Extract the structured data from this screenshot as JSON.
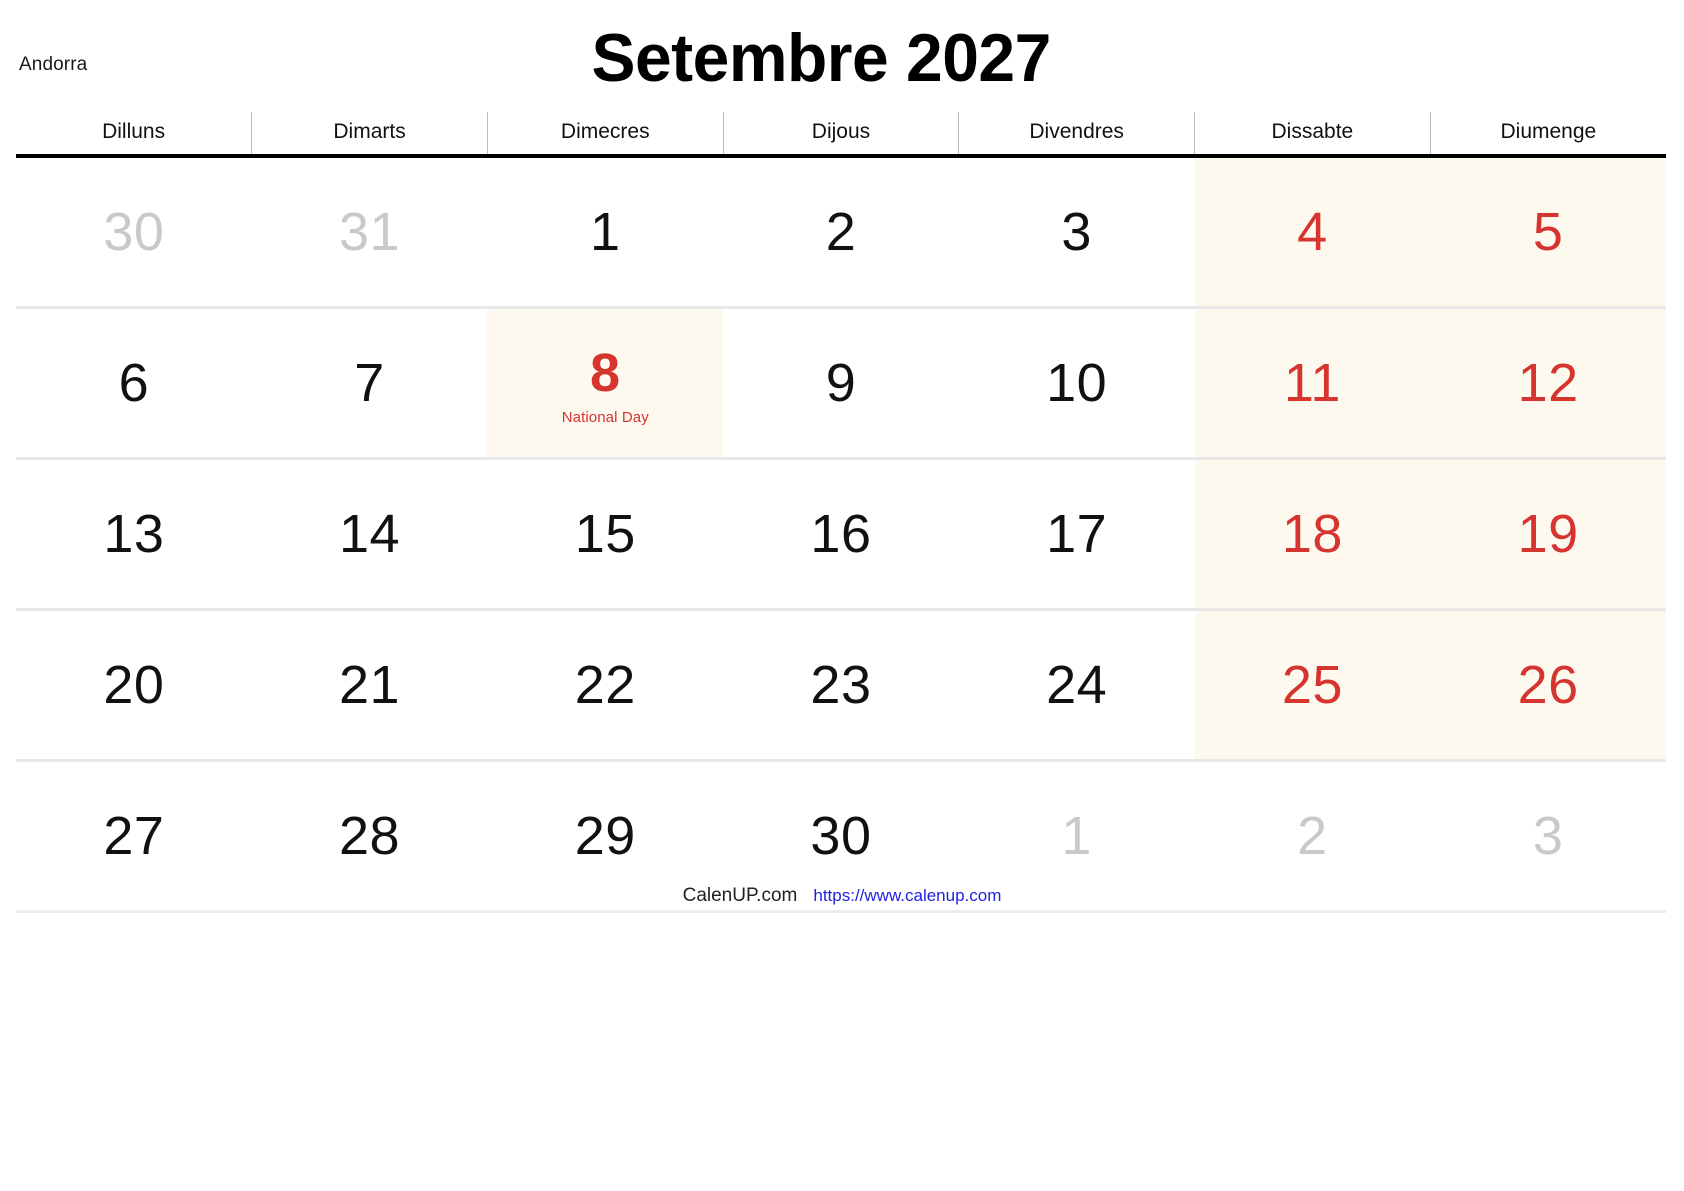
{
  "header": {
    "country": "Andorra",
    "title": "Setembre 2027"
  },
  "weekdays": [
    "Dilluns",
    "Dimarts",
    "Dimecres",
    "Dijous",
    "Divendres",
    "Dissabte",
    "Diumenge"
  ],
  "colors": {
    "holiday_red": "#d5342f",
    "weekend_shade": "#fdf9ef",
    "muted_gray": "#c9c9c9",
    "link_blue": "#2222dd",
    "header_rule": "#000000"
  },
  "weeks": [
    [
      {
        "num": "30",
        "muted": true,
        "shade": false,
        "event": ""
      },
      {
        "num": "31",
        "muted": true,
        "shade": false,
        "event": ""
      },
      {
        "num": "1",
        "muted": false,
        "shade": false,
        "event": ""
      },
      {
        "num": "2",
        "muted": false,
        "shade": false,
        "event": ""
      },
      {
        "num": "3",
        "muted": false,
        "shade": false,
        "event": ""
      },
      {
        "num": "4",
        "muted": false,
        "shade": true,
        "weekend": true,
        "event": ""
      },
      {
        "num": "5",
        "muted": false,
        "shade": true,
        "weekend": true,
        "event": ""
      }
    ],
    [
      {
        "num": "6",
        "muted": false,
        "shade": false,
        "event": ""
      },
      {
        "num": "7",
        "muted": false,
        "shade": false,
        "event": ""
      },
      {
        "num": "8",
        "muted": false,
        "shade": true,
        "holiday": true,
        "event": "National Day"
      },
      {
        "num": "9",
        "muted": false,
        "shade": false,
        "event": ""
      },
      {
        "num": "10",
        "muted": false,
        "shade": false,
        "event": ""
      },
      {
        "num": "11",
        "muted": false,
        "shade": true,
        "weekend": true,
        "event": ""
      },
      {
        "num": "12",
        "muted": false,
        "shade": true,
        "weekend": true,
        "event": ""
      }
    ],
    [
      {
        "num": "13",
        "muted": false,
        "shade": false,
        "event": ""
      },
      {
        "num": "14",
        "muted": false,
        "shade": false,
        "event": ""
      },
      {
        "num": "15",
        "muted": false,
        "shade": false,
        "event": ""
      },
      {
        "num": "16",
        "muted": false,
        "shade": false,
        "event": ""
      },
      {
        "num": "17",
        "muted": false,
        "shade": false,
        "event": ""
      },
      {
        "num": "18",
        "muted": false,
        "shade": true,
        "weekend": true,
        "event": ""
      },
      {
        "num": "19",
        "muted": false,
        "shade": true,
        "weekend": true,
        "event": ""
      }
    ],
    [
      {
        "num": "20",
        "muted": false,
        "shade": false,
        "event": ""
      },
      {
        "num": "21",
        "muted": false,
        "shade": false,
        "event": ""
      },
      {
        "num": "22",
        "muted": false,
        "shade": false,
        "event": ""
      },
      {
        "num": "23",
        "muted": false,
        "shade": false,
        "event": ""
      },
      {
        "num": "24",
        "muted": false,
        "shade": false,
        "event": ""
      },
      {
        "num": "25",
        "muted": false,
        "shade": true,
        "weekend": true,
        "event": ""
      },
      {
        "num": "26",
        "muted": false,
        "shade": true,
        "weekend": true,
        "event": ""
      }
    ],
    [
      {
        "num": "27",
        "muted": false,
        "shade": false,
        "event": ""
      },
      {
        "num": "28",
        "muted": false,
        "shade": false,
        "event": ""
      },
      {
        "num": "29",
        "muted": false,
        "shade": false,
        "event": ""
      },
      {
        "num": "30",
        "muted": false,
        "shade": false,
        "event": ""
      },
      {
        "num": "1",
        "muted": true,
        "shade": false,
        "event": ""
      },
      {
        "num": "2",
        "muted": true,
        "shade": false,
        "event": ""
      },
      {
        "num": "3",
        "muted": true,
        "shade": false,
        "event": ""
      }
    ]
  ],
  "footer": {
    "brand": "CalenUP.com",
    "url": "https://www.calenup.com"
  }
}
